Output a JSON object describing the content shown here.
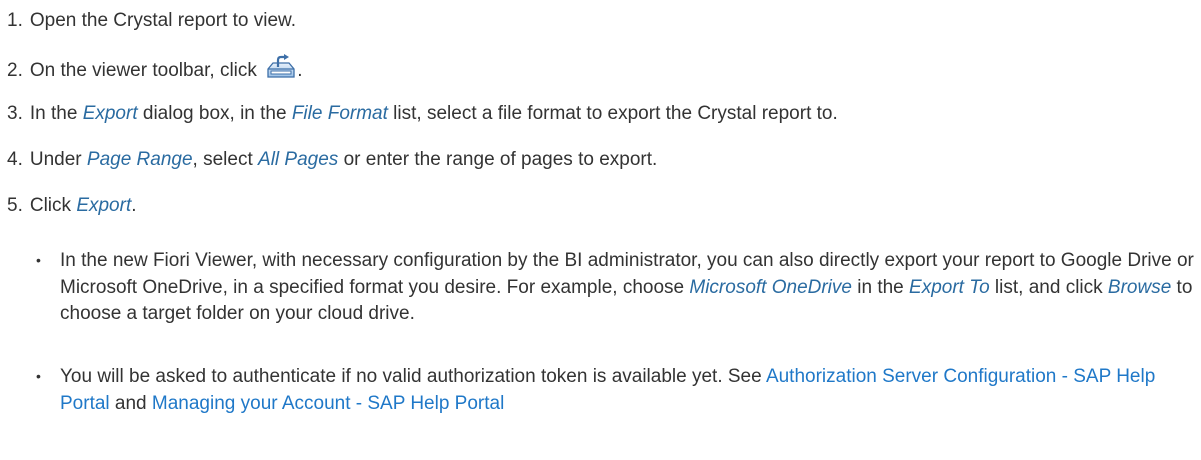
{
  "steps": [
    {
      "num": "1.",
      "text_a": "Open the Crystal report to view."
    },
    {
      "num": "2.",
      "text_a": "On the viewer toolbar, click",
      "icon": "export-icon",
      "text_b": "."
    },
    {
      "num": "3.",
      "text_a": "In the ",
      "term_a": "Export",
      "text_b": " dialog box, in the ",
      "term_b": "File Format",
      "text_c": " list, select a file format to export the Crystal report to."
    },
    {
      "num": "4.",
      "text_a": "Under ",
      "term_a": "Page Range",
      "text_b": ", select ",
      "term_b": "All Pages",
      "text_c": " or enter the range of pages to export."
    },
    {
      "num": "5.",
      "text_a": "Click ",
      "term_a": "Export",
      "text_b": "."
    }
  ],
  "notes": [
    {
      "bullet": "•",
      "text_a": "In the new Fiori Viewer, with necessary configuration by the BI administrator, you can also directly export your report to Google Drive or Microsoft OneDrive, in a specified format you desire. For example, choose ",
      "term_a": "Microsoft OneDrive",
      "text_b": " in the ",
      "term_b": "Export To",
      "text_c": " list, and click ",
      "term_c": "Browse",
      "text_d": " to choose a target folder on your cloud drive."
    },
    {
      "bullet": "•",
      "text_a": "You will be asked to authenticate if no valid authorization token is available yet. See ",
      "link_a": "Authorization Server Configuration - SAP Help Portal",
      "text_b": " and ",
      "link_b": "Managing your Account - SAP Help Portal"
    }
  ],
  "colors": {
    "text": "#333333",
    "term": "#2a6ba1",
    "link": "#1f78c8"
  }
}
